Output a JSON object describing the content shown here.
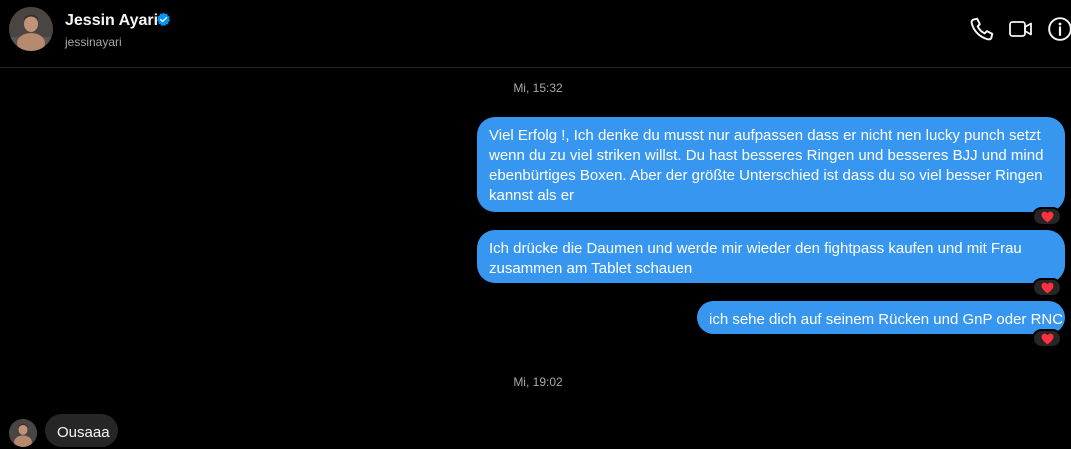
{
  "header": {
    "name": "Jessin Ayari",
    "username": "jessinayari",
    "avatar_icon": "profile-photo",
    "verified_icon": "verified-badge-icon",
    "verified_color": "#0095f6",
    "actions": [
      "phone-icon",
      "video-icon",
      "info-icon"
    ]
  },
  "timestamps": {
    "first": "Mi, 15:32",
    "second": "Mi, 19:02"
  },
  "messages": [
    {
      "from": "me",
      "lines": [
        "Viel Erfolg !,  Ich denke du musst nur aufpassen dass er nicht nen lucky punch setzt",
        "wenn du zu viel striken willst. Du hast besseres Ringen und besseres BJJ und mind",
        "ebenbürtiges Boxen. Aber der größte Unterschied ist dass du so viel besser Ringen",
        "kannst als er"
      ],
      "reaction": "heart-icon"
    },
    {
      "from": "me",
      "lines": [
        "Ich drücke die Daumen und werde mir wieder den fightpass kaufen und mit Frau",
        "zusammen am Tablet schauen"
      ],
      "reaction": "heart-icon"
    },
    {
      "from": "me",
      "lines": [
        "ich sehe dich auf seinem Rücken und GnP oder RNC"
      ],
      "reaction": "heart-icon"
    },
    {
      "from": "them",
      "lines": [
        "Ousaaa"
      ]
    }
  ],
  "colors": {
    "background": "#000000",
    "sent_bubble": "#3797f0",
    "received_bubble": "#262626",
    "reaction_heart": "#ff3040"
  }
}
